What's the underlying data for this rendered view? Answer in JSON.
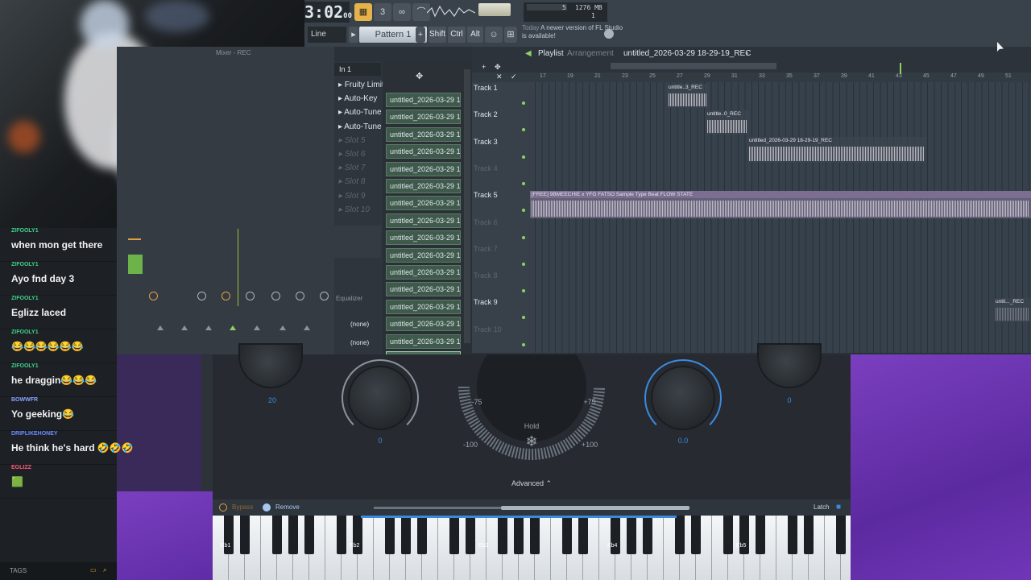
{
  "toolbar": {
    "clock": "3:02",
    "clock_sub": "00",
    "cpu_value": "5",
    "mem_value": "1276 MB",
    "voices": "1",
    "snap_label": "Line",
    "pattern_label": "Pattern 1",
    "shift_label": "Shift",
    "ctrl_label": "Ctrl",
    "alt_label": "Alt",
    "news_today": "Today",
    "news_text": "A newer version of FL Studio is available!"
  },
  "mixer": {
    "title": "Mixer - REC",
    "input": "In 1",
    "fx_slots": [
      {
        "label": "Fruity Limit",
        "dim": false
      },
      {
        "label": "Auto-Key",
        "dim": false
      },
      {
        "label": "Auto-Tune",
        "dim": false
      },
      {
        "label": "Auto-Tune",
        "dim": false
      },
      {
        "label": "Slot 5",
        "dim": true
      },
      {
        "label": "Slot 6",
        "dim": true
      },
      {
        "label": "Slot 7",
        "dim": true
      },
      {
        "label": "Slot 8",
        "dim": true
      },
      {
        "label": "Slot 9",
        "dim": true
      },
      {
        "label": "Slot 10",
        "dim": true
      }
    ],
    "equalizer_label": "Equalizer",
    "none_1": "(none)",
    "none_2": "(none)"
  },
  "browser": {
    "items": [
      "untitled_2026-03-29 18-...",
      "untitled_2026-03-29 18-...",
      "untitled_2026-03-29 18-...",
      "untitled_2026-03-29 18-...",
      "untitled_2026-03-29 18-...",
      "untitled_2026-03-29 18-...",
      "untitled_2026-03-29 18-...",
      "untitled_2026-03-29 18-...",
      "untitled_2026-03-29 18-...",
      "untitled_2026-03-29 18-...",
      "untitled_2026-03-29 18-...",
      "untitled_2026-03-29 18-...",
      "untitled_2026-03-29 18-...",
      "untitled_2026-03-29 18-...",
      "untitled_2026-03-29 18-...",
      "untitled_2026-03-29 18-..."
    ]
  },
  "playlist": {
    "title": "Playlist",
    "sub": "Arrangement",
    "file": "untitled_2026-03-29 18-29-19_REC",
    "ruler": [
      "17",
      "19",
      "21",
      "23",
      "25",
      "27",
      "29",
      "31",
      "33",
      "35",
      "37",
      "39",
      "41",
      "43",
      "45",
      "47",
      "49",
      "51"
    ],
    "tracks": [
      {
        "label": "Track 1",
        "dim": false
      },
      {
        "label": "Track 2",
        "dim": false
      },
      {
        "label": "Track 3",
        "dim": false
      },
      {
        "label": "Track 4",
        "dim": true
      },
      {
        "label": "Track 5",
        "dim": false
      },
      {
        "label": "Track 6",
        "dim": true
      },
      {
        "label": "Track 7",
        "dim": true
      },
      {
        "label": "Track 8",
        "dim": true
      },
      {
        "label": "Track 9",
        "dim": false
      },
      {
        "label": "Track 10",
        "dim": true
      }
    ],
    "clips": [
      {
        "label": "untitle..3_REC"
      },
      {
        "label": "untitle..0_REC"
      },
      {
        "label": "untitled_2026-03-29 18-29-19_REC"
      },
      {
        "label": "[FREE] 9BMEECHIE x YFG FATSO Sample Type Beat FLOW STATE"
      },
      {
        "label": "untit..._REC"
      }
    ]
  },
  "plugin": {
    "knob_left_value": "20",
    "knob_a_value": "0",
    "knob_b_value": "0.0",
    "knob_right_value": "0",
    "dial_minus75": "-75",
    "dial_plus75": "+75",
    "dial_minus100": "-100",
    "dial_plus100": "+100",
    "hold_label": "Hold",
    "advanced_label": "Advanced",
    "bypass_label": "Bypass",
    "remove_label": "Remove",
    "latch_label": "Latch",
    "key_labels": [
      "Eb1",
      "Eb2",
      "Eb3",
      "Eb4",
      "Eb5"
    ]
  },
  "chat": {
    "messages": [
      {
        "user": "ZIFOOLY1",
        "text": "when mon get there",
        "color": "#3fd38a"
      },
      {
        "user": "ZIFOOLY1",
        "text": "Ayo fnd day 3",
        "color": "#3fd38a"
      },
      {
        "user": "ZIFOOLY1",
        "text": "Eglizz laced",
        "color": "#3fd38a"
      },
      {
        "user": "ZIFOOLY1",
        "text": "😂😂😂😂😂😂",
        "color": "#3fd38a"
      },
      {
        "user": "ZIFOOLY1",
        "text": "he draggin😂😂😂",
        "color": "#3fd38a"
      },
      {
        "user": "BOWWFR",
        "text": "Yo geeking😂",
        "color": "#8aa0ff"
      },
      {
        "user": "DRIPLIKEHONEY",
        "text": "He think he's hard 🤣🤣🤣",
        "color": "#6a8cff"
      },
      {
        "user": "EGLIZZ",
        "text": "🟩",
        "color": "#ff5a7a"
      }
    ],
    "tags_label": "TAGS"
  },
  "colors": {
    "accent": "#3a8ae0",
    "selected": "#e6b34a",
    "clip_green": "#8ed066",
    "purple": "#6a33b0"
  }
}
